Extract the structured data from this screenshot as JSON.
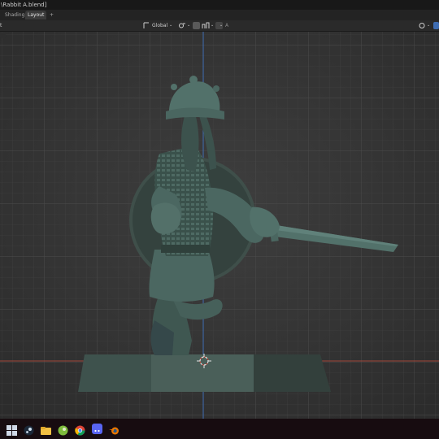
{
  "window": {
    "title": "\\Rabbit A.blend]"
  },
  "workspace_tabs": [
    {
      "label": "Shading",
      "active": false
    },
    {
      "label": "Layout",
      "active": true
    },
    {
      "label": "+",
      "active": false
    }
  ],
  "viewport_header": {
    "left_mark": "t",
    "transform_orientation": "Global",
    "snap_mark": "A"
  },
  "taskbar": {
    "icons": [
      "windows-start-icon",
      "steam-icon",
      "file-explorer-icon",
      "gecko-icon",
      "chrome-icon",
      "discord-icon",
      "blender-icon"
    ]
  },
  "colors": {
    "model": "#3f5751",
    "grid_bg": "#3b3b3b",
    "x_axis": "#a1473a",
    "z_axis": "#3f6db2"
  }
}
